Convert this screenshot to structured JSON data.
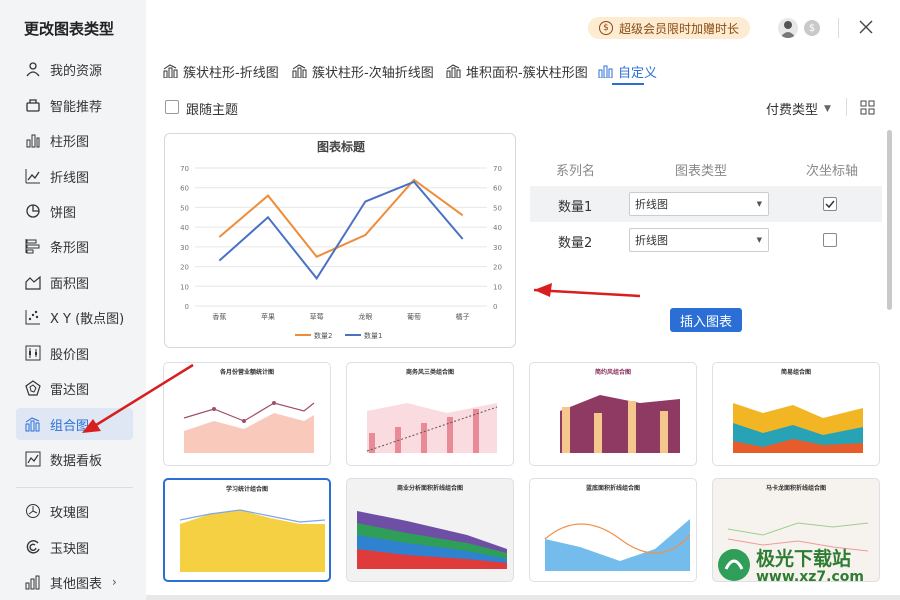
{
  "sidebar": {
    "title": "更改图表类型",
    "items": [
      {
        "label": "我的资源",
        "icon": "user-icon"
      },
      {
        "label": "智能推荐",
        "icon": "star-icon"
      },
      {
        "label": "柱形图",
        "icon": "column-chart-icon"
      },
      {
        "label": "折线图",
        "icon": "line-chart-icon"
      },
      {
        "label": "饼图",
        "icon": "pie-chart-icon"
      },
      {
        "label": "条形图",
        "icon": "bar-chart-icon"
      },
      {
        "label": "面积图",
        "icon": "area-chart-icon"
      },
      {
        "label": "X Y (散点图)",
        "icon": "scatter-chart-icon"
      },
      {
        "label": "股价图",
        "icon": "stock-chart-icon"
      },
      {
        "label": "雷达图",
        "icon": "radar-chart-icon"
      },
      {
        "label": "组合图",
        "icon": "combo-chart-icon",
        "active": true
      },
      {
        "label": "数据看板",
        "icon": "dashboard-icon"
      },
      {
        "label": "玫瑰图",
        "icon": "rose-chart-icon"
      },
      {
        "label": "玉玦图",
        "icon": "jade-ring-chart-icon"
      },
      {
        "label": "其他图表",
        "icon": "other-chart-icon"
      }
    ]
  },
  "header": {
    "promo": "超级会员限时加赠时长",
    "promo_icon": "dollar-icon",
    "coin_glyph": "$"
  },
  "tabs": [
    {
      "label": "簇状柱形-折线图"
    },
    {
      "label": "簇状柱形-次轴折线图"
    },
    {
      "label": "堆积面积-簇状柱形图"
    },
    {
      "label": "自定义",
      "active": true
    }
  ],
  "options": {
    "follow_theme": "跟随主题",
    "pay_type": "付费类型"
  },
  "series_table": {
    "headers": [
      "系列名",
      "图表类型",
      "次坐标轴"
    ],
    "rows": [
      {
        "name": "数量1",
        "type": "折线图",
        "secondary": true
      },
      {
        "name": "数量2",
        "type": "折线图",
        "secondary": false
      }
    ]
  },
  "insert_button": "插入图表",
  "thumbnails": [
    "各月份营业额统计图",
    "商务风三类组合图",
    "简约风组合图",
    "简易组合图",
    "学习统计组合图",
    "商业分析面积折线组合图",
    "蓝底面积折线组合图",
    "马卡龙面积折线组合图"
  ],
  "watermark": {
    "line1": "极光下载站",
    "line2": "www.xz7.com"
  },
  "chart_data": {
    "type": "line",
    "title": "图表标题",
    "categories": [
      "香蕉",
      "苹果",
      "草莓",
      "龙眼",
      "葡萄",
      "橘子"
    ],
    "series": [
      {
        "name": "数量2",
        "values": [
          35,
          56,
          25,
          36,
          64,
          46
        ],
        "color": "#ed8c3a"
      },
      {
        "name": "数量1",
        "values": [
          23,
          45,
          14,
          53,
          63,
          34
        ],
        "color": "#4a72c4"
      }
    ],
    "ylim": [
      0,
      70
    ],
    "yticks": [
      0,
      10,
      20,
      30,
      40,
      50,
      60,
      70
    ],
    "grid": true,
    "legend": "bottom"
  }
}
